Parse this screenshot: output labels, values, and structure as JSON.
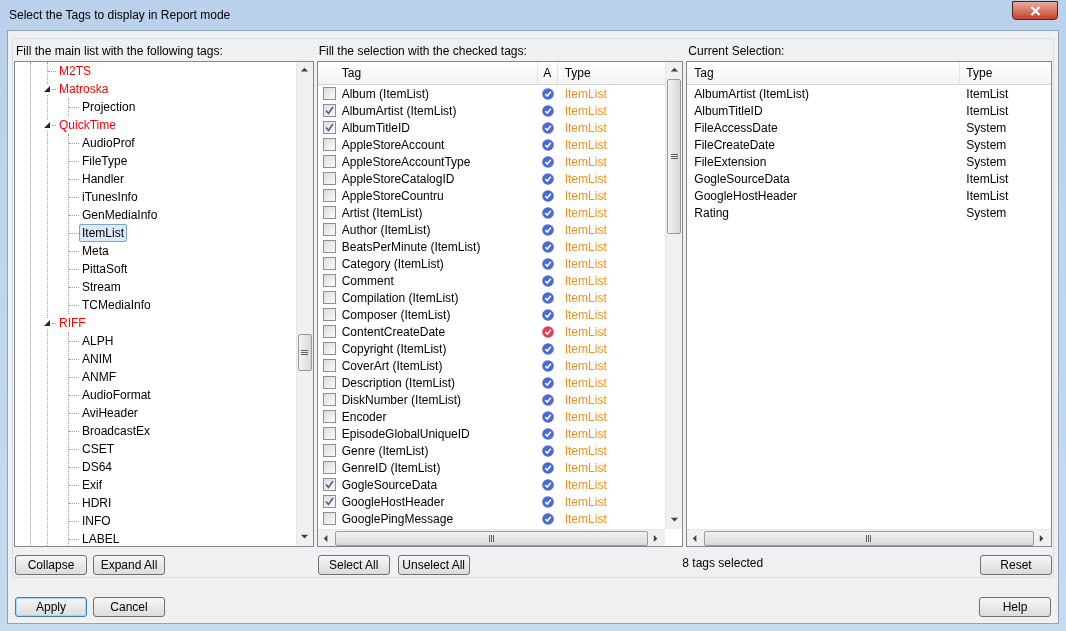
{
  "window": {
    "title": "Select the Tags to display in Report mode"
  },
  "tree_panel": {
    "label": "Fill the main list with the following tags:",
    "nodes": [
      {
        "label": "M2TS",
        "selected": false
      },
      {
        "label": "Matroska",
        "selected": false,
        "expanded": true,
        "children": [
          {
            "label": "Projection",
            "selected": false
          }
        ]
      },
      {
        "label": "QuickTime",
        "selected": false,
        "expanded": true,
        "children": [
          {
            "label": "AudioProf",
            "selected": false
          },
          {
            "label": "FileType",
            "selected": false
          },
          {
            "label": "Handler",
            "selected": false
          },
          {
            "label": "iTunesInfo",
            "selected": false
          },
          {
            "label": "GenMediaInfo",
            "selected": false
          },
          {
            "label": "ItemList",
            "selected": true
          },
          {
            "label": "Meta",
            "selected": false
          },
          {
            "label": "PittaSoft",
            "selected": false
          },
          {
            "label": "Stream",
            "selected": false
          },
          {
            "label": "TCMediaInfo",
            "selected": false
          }
        ]
      },
      {
        "label": "RIFF",
        "selected": false,
        "expanded": true,
        "children": [
          {
            "label": "ALPH",
            "selected": false
          },
          {
            "label": "ANIM",
            "selected": false
          },
          {
            "label": "ANMF",
            "selected": false
          },
          {
            "label": "AudioFormat",
            "selected": false
          },
          {
            "label": "AviHeader",
            "selected": false
          },
          {
            "label": "BroadcastEx",
            "selected": false
          },
          {
            "label": "CSET",
            "selected": false
          },
          {
            "label": "DS64",
            "selected": false
          },
          {
            "label": "Exif",
            "selected": false
          },
          {
            "label": "HDRI",
            "selected": false
          },
          {
            "label": "INFO",
            "selected": false
          },
          {
            "label": "LABEL",
            "selected": false
          }
        ]
      }
    ],
    "buttons": [
      "Collapse",
      "Expand All"
    ]
  },
  "tag_panel": {
    "label": "Fill the selection with the checked tags:",
    "columns": [
      "Tag",
      "A",
      "Type"
    ],
    "rows": [
      {
        "tag": "Album (ItemList)",
        "checked": false,
        "color": "#4a6ad8",
        "type": "ItemList"
      },
      {
        "tag": "AlbumArtist (ItemList)",
        "checked": true,
        "color": "#4a6ad8",
        "type": "ItemList"
      },
      {
        "tag": "AlbumTitleID",
        "checked": true,
        "color": "#4a6ad8",
        "type": "ItemList"
      },
      {
        "tag": "AppleStoreAccount",
        "checked": false,
        "color": "#4a6ad8",
        "type": "ItemList"
      },
      {
        "tag": "AppleStoreAccountType",
        "checked": false,
        "color": "#4a6ad8",
        "type": "ItemList"
      },
      {
        "tag": "AppleStoreCatalogID",
        "checked": false,
        "color": "#4a6ad8",
        "type": "ItemList"
      },
      {
        "tag": "AppleStoreCountru",
        "checked": false,
        "color": "#4a6ad8",
        "type": "ItemList"
      },
      {
        "tag": "Artist (ItemList)",
        "checked": false,
        "color": "#4a6ad8",
        "type": "ItemList"
      },
      {
        "tag": "Author (ItemList)",
        "checked": false,
        "color": "#4a6ad8",
        "type": "ItemList"
      },
      {
        "tag": "BeatsPerMinute (ItemList)",
        "checked": false,
        "color": "#4a6ad8",
        "type": "ItemList"
      },
      {
        "tag": "Category (ItemList)",
        "checked": false,
        "color": "#4a6ad8",
        "type": "ItemList"
      },
      {
        "tag": "Comment",
        "checked": false,
        "color": "#4a6ad8",
        "type": "ItemList"
      },
      {
        "tag": "Compilation (ItemList)",
        "checked": false,
        "color": "#4a6ad8",
        "type": "ItemList"
      },
      {
        "tag": "Composer (ItemList)",
        "checked": false,
        "color": "#4a6ad8",
        "type": "ItemList"
      },
      {
        "tag": "ContentCreateDate",
        "checked": false,
        "color": "#e0405a",
        "type": "ItemList"
      },
      {
        "tag": "Copyright (ItemList)",
        "checked": false,
        "color": "#4a6ad8",
        "type": "ItemList"
      },
      {
        "tag": "CoverArt (ItemList)",
        "checked": false,
        "color": "#4a6ad8",
        "type": "ItemList"
      },
      {
        "tag": "Description (ItemList)",
        "checked": false,
        "color": "#4a6ad8",
        "type": "ItemList"
      },
      {
        "tag": "DiskNumber (ItemList)",
        "checked": false,
        "color": "#4a6ad8",
        "type": "ItemList"
      },
      {
        "tag": "Encoder",
        "checked": false,
        "color": "#4a6ad8",
        "type": "ItemList"
      },
      {
        "tag": "EpisodeGlobalUniqueID",
        "checked": false,
        "color": "#4a6ad8",
        "type": "ItemList"
      },
      {
        "tag": "Genre (ItemList)",
        "checked": false,
        "color": "#4a6ad8",
        "type": "ItemList"
      },
      {
        "tag": "GenreID (ItemList)",
        "checked": false,
        "color": "#4a6ad8",
        "type": "ItemList"
      },
      {
        "tag": "GogleSourceData",
        "checked": true,
        "color": "#4a6ad8",
        "type": "ItemList"
      },
      {
        "tag": "GoogleHostHeader",
        "checked": true,
        "color": "#4a6ad8",
        "type": "ItemList"
      },
      {
        "tag": "GooglePingMessage",
        "checked": false,
        "color": "#4a6ad8",
        "type": "ItemList"
      }
    ],
    "buttons": [
      "Select All",
      "Unselect All"
    ]
  },
  "selection_panel": {
    "label": "Current Selection:",
    "columns": [
      "Tag",
      "Type"
    ],
    "rows": [
      {
        "tag": "AlbumArtist (ItemList)",
        "type": "ItemList"
      },
      {
        "tag": "AlbumTitleID",
        "type": "ItemList"
      },
      {
        "tag": "FileAccessDate",
        "type": "System"
      },
      {
        "tag": "FileCreateDate",
        "type": "System"
      },
      {
        "tag": "FileExtension",
        "type": "System"
      },
      {
        "tag": "GogleSourceData",
        "type": "ItemList"
      },
      {
        "tag": "GoogleHostHeader",
        "type": "ItemList"
      },
      {
        "tag": "Rating",
        "type": "System"
      }
    ],
    "count": "8 tags selected",
    "button": "Reset"
  },
  "footer_buttons": [
    {
      "label": "Apply",
      "focused": true
    },
    {
      "label": "Cancel",
      "focused": false
    }
  ],
  "help_button": "Help"
}
